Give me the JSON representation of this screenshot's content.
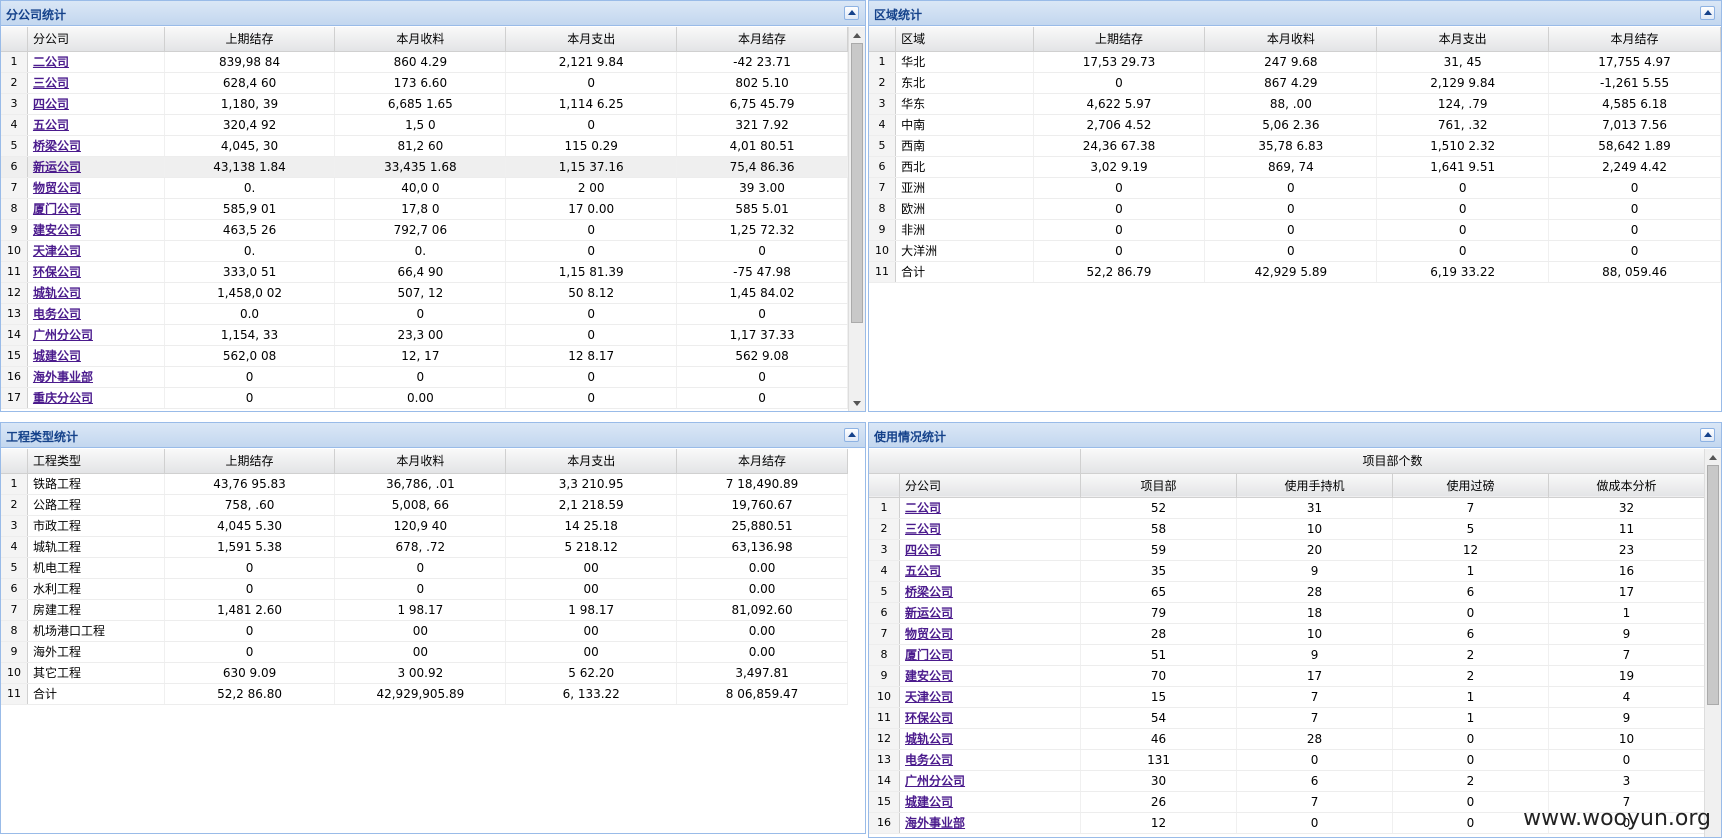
{
  "p1": {
    "title": "分公司统计",
    "headers": [
      "分公司",
      "上期结存",
      "本月收料",
      "本月支出",
      "本月结存"
    ],
    "rows": [
      [
        "1",
        "二公司",
        "839,98   84",
        "860   4.29",
        "2,121   9.84",
        "-42   23.71"
      ],
      [
        "2",
        "三公司",
        "628,4   60",
        "173   6.60",
        "0",
        "802   5.10"
      ],
      [
        "3",
        "四公司",
        "1,180,   39",
        "6,685   1.65",
        "1,114   6.25",
        "6,75   45.79"
      ],
      [
        "4",
        "五公司",
        "320,4   92",
        "1,5   0",
        "0",
        "321   7.92"
      ],
      [
        "5",
        "桥梁公司",
        "4,045,   30",
        "81,2   60",
        "115   0.29",
        "4,01   80.51"
      ],
      [
        "6",
        "新运公司",
        "43,138   1.84",
        "33,435   1.68",
        "1,15   37.16",
        "75,4   86.36"
      ],
      [
        "7",
        "物贸公司",
        "0.",
        "40,0   0",
        "2   00",
        "39   3.00"
      ],
      [
        "8",
        "厦门公司",
        "585,9   01",
        "17,8   0",
        "17   0.00",
        "585   5.01"
      ],
      [
        "9",
        "建安公司",
        "463,5   26",
        "792,7   06",
        "0",
        "1,25   72.32"
      ],
      [
        "10",
        "天津公司",
        "0.",
        "0.",
        "0",
        "0"
      ],
      [
        "11",
        "环保公司",
        "333,0   51",
        "66,4   90",
        "1,15   81.39",
        "-75   47.98"
      ],
      [
        "12",
        "城轨公司",
        "1,458,0   02",
        "507,   12",
        "50   8.12",
        "1,45   84.02"
      ],
      [
        "13",
        "电务公司",
        "0.0",
        "0",
        "0",
        "0"
      ],
      [
        "14",
        "广州分公司",
        "1,154,   33",
        "23,3   00",
        "0",
        "1,17   37.33"
      ],
      [
        "15",
        "城建公司",
        "562,0   08",
        "12,   17",
        "12   8.17",
        "562   9.08"
      ],
      [
        "16",
        "海外事业部",
        "0",
        "0",
        "0",
        "0"
      ],
      [
        "17",
        "重庆分公司",
        "0",
        "0.00",
        "0",
        "0"
      ]
    ]
  },
  "p2": {
    "title": "区域统计",
    "headers": [
      "区域",
      "上期结存",
      "本月收料",
      "本月支出",
      "本月结存"
    ],
    "rows": [
      [
        "1",
        "华北",
        "17,53   29.73",
        "247   9.68",
        "31,   45",
        "17,755   4.97"
      ],
      [
        "2",
        "东北",
        "0",
        "867   4.29",
        "2,129   9.84",
        "-1,261   5.55"
      ],
      [
        "3",
        "华东",
        "4,622   5.97",
        "88,   .00",
        "124,   .79",
        "4,585   6.18"
      ],
      [
        "4",
        "中南",
        "2,706   4.52",
        "5,06   2.36",
        "761,   .32",
        "7,013   7.56"
      ],
      [
        "5",
        "西南",
        "24,36   67.38",
        "35,78   6.83",
        "1,510   2.32",
        "58,642   1.89"
      ],
      [
        "6",
        "西北",
        "3,02   9.19",
        "869,   74",
        "1,641   9.51",
        "2,249   4.42"
      ],
      [
        "7",
        "亚洲",
        "0",
        "0",
        "0",
        "0"
      ],
      [
        "8",
        "欧洲",
        "0",
        "0",
        "0",
        "0"
      ],
      [
        "9",
        "非洲",
        "0",
        "0",
        "0",
        "0"
      ],
      [
        "10",
        "大洋洲",
        "0",
        "0",
        "0",
        "0"
      ],
      [
        "11",
        "合计",
        "52,2   86.79",
        "42,929   5.89",
        "6,19   33.22",
        "88,   059.46"
      ]
    ]
  },
  "p3": {
    "title": "工程类型统计",
    "headers": [
      "工程类型",
      "上期结存",
      "本月收料",
      "本月支出",
      "本月结存"
    ],
    "rows": [
      [
        "1",
        "铁路工程",
        "43,76   95.83",
        "36,786,   .01",
        "3,3   210.95",
        "7   18,490.89"
      ],
      [
        "2",
        "公路工程",
        "758,   .60",
        "5,008,   66",
        "2,1   218.59",
        "   19,760.67"
      ],
      [
        "3",
        "市政工程",
        "4,045   5.30",
        "120,9   40",
        "14   25.18",
        "   25,880.51"
      ],
      [
        "4",
        "城轨工程",
        "1,591   5.38",
        "678,   .72",
        "5   218.12",
        "   63,136.98"
      ],
      [
        "5",
        "机电工程",
        "0",
        "0",
        "00",
        "0.00"
      ],
      [
        "6",
        "水利工程",
        "0",
        "0",
        "00",
        "0.00"
      ],
      [
        "7",
        "房建工程",
        "1,481   2.60",
        "1   98.17",
        "1   98.17",
        "   81,092.60"
      ],
      [
        "8",
        "机场港口工程",
        "0",
        "00",
        "00",
        "0.00"
      ],
      [
        "9",
        "海外工程",
        "0",
        "00",
        "00",
        "0.00"
      ],
      [
        "10",
        "其它工程",
        "630   9.09",
        "3   00.92",
        "5   62.20",
        "   3,497.81"
      ],
      [
        "11",
        "合计",
        "52,2   86.80",
        "42,929,905.89",
        "6,   133.22",
        "8   06,859.47"
      ]
    ]
  },
  "p4": {
    "title": "使用情况统计",
    "group_header": "项目部个数",
    "headers": [
      "分公司",
      "项目部",
      "使用手持机",
      "使用过磅",
      "做成本分析"
    ],
    "rows": [
      [
        "1",
        "二公司",
        "52",
        "31",
        "7",
        "32"
      ],
      [
        "2",
        "三公司",
        "58",
        "10",
        "5",
        "11"
      ],
      [
        "3",
        "四公司",
        "59",
        "20",
        "12",
        "23"
      ],
      [
        "4",
        "五公司",
        "35",
        "9",
        "1",
        "16"
      ],
      [
        "5",
        "桥梁公司",
        "65",
        "28",
        "6",
        "17"
      ],
      [
        "6",
        "新运公司",
        "79",
        "18",
        "0",
        "1"
      ],
      [
        "7",
        "物贸公司",
        "28",
        "10",
        "6",
        "9"
      ],
      [
        "8",
        "厦门公司",
        "51",
        "9",
        "2",
        "7"
      ],
      [
        "9",
        "建安公司",
        "70",
        "17",
        "2",
        "19"
      ],
      [
        "10",
        "天津公司",
        "15",
        "7",
        "1",
        "4"
      ],
      [
        "11",
        "环保公司",
        "54",
        "7",
        "1",
        "9"
      ],
      [
        "12",
        "城轨公司",
        "46",
        "28",
        "0",
        "10"
      ],
      [
        "13",
        "电务公司",
        "131",
        "0",
        "0",
        "0"
      ],
      [
        "14",
        "广州分公司",
        "30",
        "6",
        "2",
        "3"
      ],
      [
        "15",
        "城建公司",
        "26",
        "7",
        "0",
        "7"
      ],
      [
        "16",
        "海外事业部",
        "12",
        "0",
        "0",
        "0"
      ]
    ]
  },
  "watermark": "www.wooyun.org"
}
